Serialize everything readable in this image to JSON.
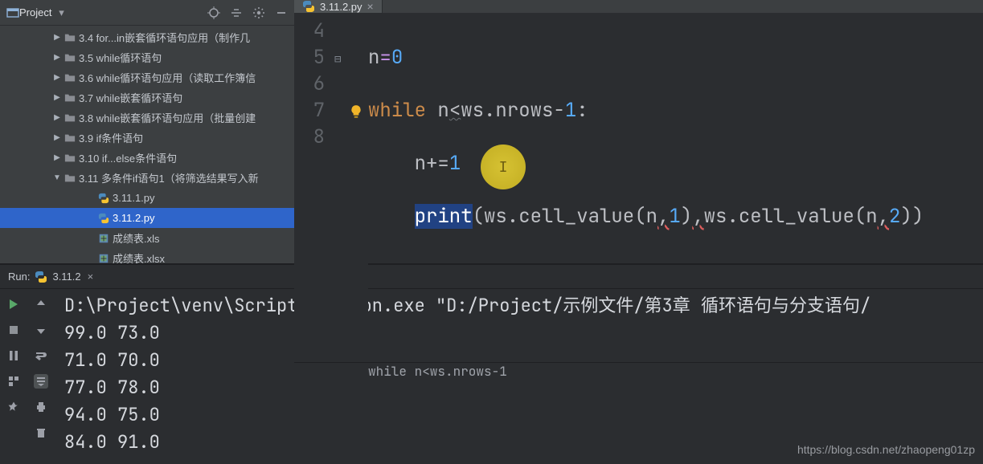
{
  "sidebar": {
    "title": "Project",
    "items": [
      {
        "indent": 64,
        "arrow": "▶",
        "type": "folder",
        "label": "3.4 for...in嵌套循环语句应用（制作几"
      },
      {
        "indent": 64,
        "arrow": "▶",
        "type": "folder",
        "label": "3.5 while循环语句"
      },
      {
        "indent": 64,
        "arrow": "▶",
        "type": "folder",
        "label": "3.6 while循环语句应用（读取工作簿信"
      },
      {
        "indent": 64,
        "arrow": "▶",
        "type": "folder",
        "label": "3.7 while嵌套循环语句"
      },
      {
        "indent": 64,
        "arrow": "▶",
        "type": "folder",
        "label": "3.8 while嵌套循环语句应用（批量创建"
      },
      {
        "indent": 64,
        "arrow": "▶",
        "type": "folder",
        "label": "3.9 if条件语句"
      },
      {
        "indent": 64,
        "arrow": "▶",
        "type": "folder",
        "label": "3.10 if...else条件语句"
      },
      {
        "indent": 64,
        "arrow": "▼",
        "type": "folder",
        "label": "3.11 多条件if语句1（将筛选结果写入新"
      },
      {
        "indent": 106,
        "arrow": "",
        "type": "py",
        "label": "3.11.1.py"
      },
      {
        "indent": 106,
        "arrow": "",
        "type": "py",
        "label": "3.11.2.py",
        "selected": true
      },
      {
        "indent": 106,
        "arrow": "",
        "type": "xls",
        "label": "成绩表.xls"
      },
      {
        "indent": 106,
        "arrow": "",
        "type": "xls",
        "label": "成绩表.xlsx"
      }
    ]
  },
  "tab": {
    "file": "3.11.2.py"
  },
  "code": {
    "line_numbers": [
      "4",
      "5",
      "6",
      "7",
      "8"
    ],
    "l4_a": "n",
    "l4_b": "=",
    "l4_c": "0",
    "l5_a": "while",
    "l5_b": " n",
    "l5_c": "<",
    "l5_d": "ws.nrows-",
    "l5_e": "1",
    "l5_f": ":",
    "l6_a": "    n+=",
    "l6_b": "1",
    "l7_a": "    ",
    "l7_b": "print",
    "l7_c": "(ws.cell_value(n",
    "l7_d": ",",
    "l7_e": "1",
    "l7_f": ")",
    "l7_g": ",",
    "l7_h": "ws.cell_value(n",
    "l7_i": ",",
    "l7_j": "2",
    "l7_k": "))"
  },
  "breadcrumb": "while n<ws.nrows-1",
  "run": {
    "label": "Run:",
    "config": "3.11.2",
    "cmd": "D:\\Project\\venv\\Scripts\\python.exe \"D:/Project/示例文件/第3章 循环语句与分支语句/",
    "rows": [
      "99.0 73.0",
      "71.0 70.0",
      "77.0 78.0",
      "94.0 75.0",
      "84.0 91.0"
    ]
  },
  "watermark": "https://blog.csdn.net/zhaopeng01zp"
}
